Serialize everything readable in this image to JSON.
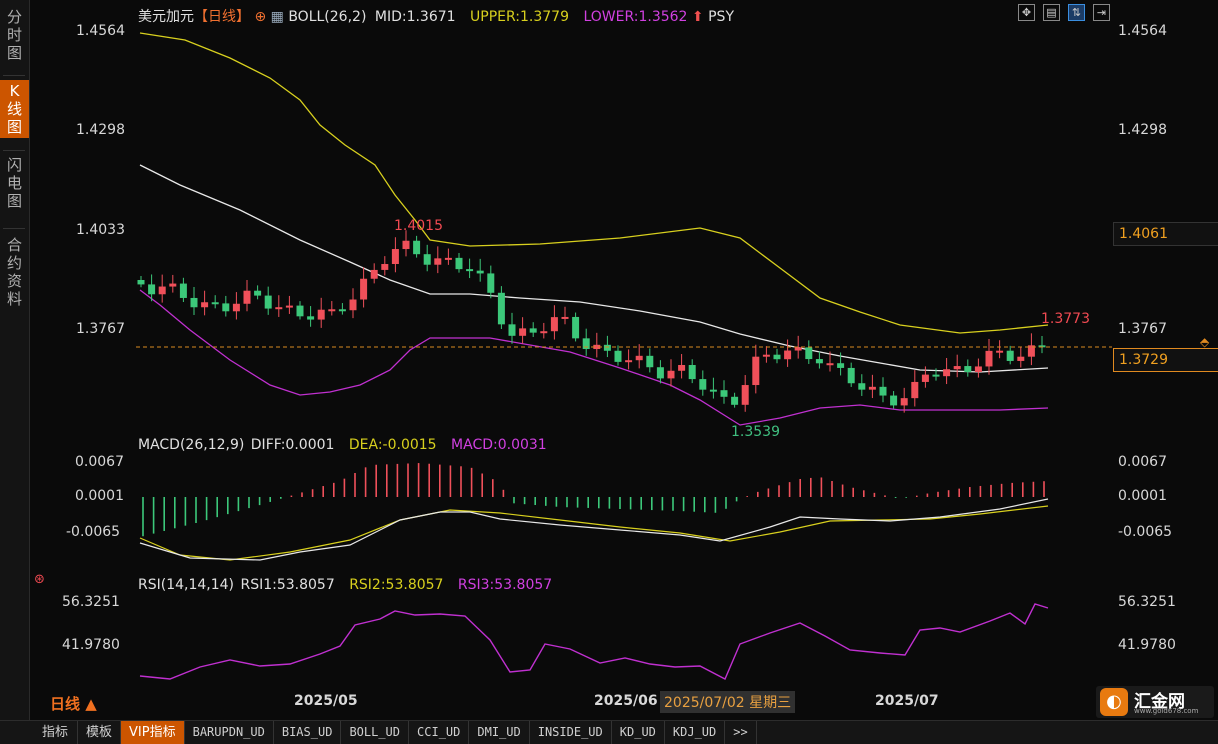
{
  "sidebar": {
    "tabs": [
      {
        "label": [
          "分",
          "时",
          "图"
        ],
        "active": false
      },
      {
        "label": [
          "K",
          "线",
          "图"
        ],
        "active": true
      },
      {
        "label": [
          "闪",
          "电",
          "图"
        ],
        "active": false
      },
      {
        "label": [
          "合",
          "约",
          "资",
          "料"
        ],
        "active": false
      }
    ]
  },
  "main_header": {
    "symbol": "美元加元",
    "period": "【日线】",
    "indicator": "BOLL(26,2)",
    "mid": "MID:1.3671",
    "upper": "UPPER:1.3779",
    "lower": "LOWER:1.3562",
    "psy": "PSY"
  },
  "price_axis": {
    "left_ticks": [
      "1.4564",
      "1.4298",
      "1.4033",
      "1.3767"
    ],
    "right_ticks": [
      "1.4564",
      "1.4298",
      "1.3767"
    ],
    "right_box_value": "1.4061",
    "current_price": "1.3729"
  },
  "annotations": {
    "high_label": "1.4015",
    "low_label": "1.3539",
    "last_label": "1.3773"
  },
  "macd_header": {
    "name": "MACD(26,12,9)",
    "diff": "DIFF:0.0001",
    "dea": "DEA:-0.0015",
    "macd": "MACD:0.0031"
  },
  "macd_axis": {
    "ticks": [
      "0.0067",
      "0.0001",
      "-0.0065"
    ]
  },
  "rsi_header": {
    "name": "RSI(14,14,14)",
    "rsi1": "RSI1:53.8057",
    "rsi2": "RSI2:53.8057",
    "rsi3": "RSI3:53.8057"
  },
  "rsi_axis": {
    "ticks": [
      "56.3251",
      "41.9780"
    ]
  },
  "time_axis": {
    "labels": [
      "2025/05",
      "2025/06",
      "2025/07"
    ],
    "cursor_label": "2025/07/02 星期三"
  },
  "period_button": "日线 ▲",
  "brand": {
    "name": "汇金网",
    "url": "www.gold678.com"
  },
  "toolbar_icons": [
    "fullscreen-icon",
    "grid-icon",
    "linked-chart-icon",
    "export-icon"
  ],
  "bottom_bar": {
    "items": [
      "指标",
      "模板",
      "VIP指标",
      "BARUPDN_UD",
      "BIAS_UD",
      "BOLL_UD",
      "CCI_UD",
      "DMI_UD",
      "INSIDE_UD",
      "KD_UD",
      "KDJ_UD",
      ">>"
    ]
  },
  "colors": {
    "up": "#f0505a",
    "down": "#3cc87a",
    "mid_line": "#e8e8e8",
    "upper_line": "#d8d01e",
    "lower_line": "#c030d0",
    "accent": "#cc5500"
  }
}
